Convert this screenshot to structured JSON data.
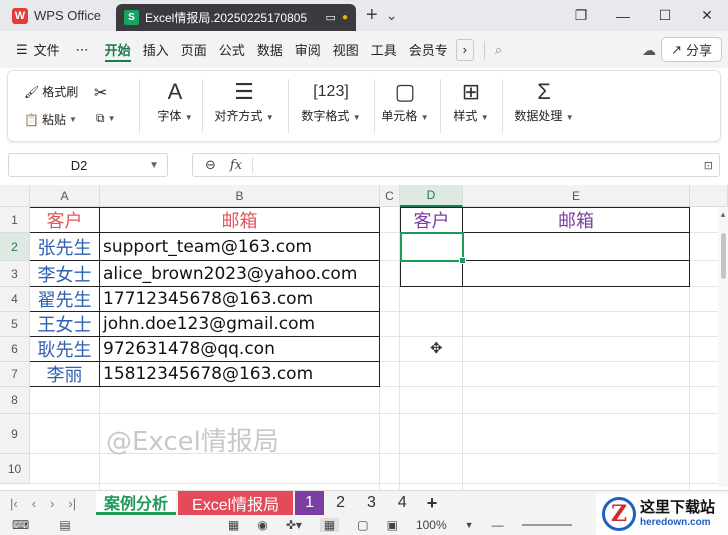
{
  "titlebar": {
    "app_name": "WPS Office",
    "doc_tab": "Excel情报局.20250225170805",
    "doc_icon": "S",
    "add": "+",
    "chevron": "⌄",
    "window_buttons": [
      "❐",
      "—",
      "☐",
      "✕"
    ]
  },
  "menubar": {
    "file": "文件",
    "more": "⋯",
    "items": [
      "开始",
      "插入",
      "页面",
      "公式",
      "数据",
      "审阅",
      "视图",
      "工具",
      "会员专"
    ],
    "share": "分享"
  },
  "ribbon": {
    "format_painter": "格式刷",
    "paste": "粘贴",
    "font": "字体",
    "align": "对齐方式",
    "number_format": "数字格式",
    "cell": "单元格",
    "style": "样式",
    "data_process": "数据处理"
  },
  "formulabar": {
    "cell_ref": "D2",
    "fx": "fx",
    "content": ""
  },
  "grid": {
    "columns": [
      "A",
      "B",
      "C",
      "D",
      "E"
    ],
    "rows": [
      "1",
      "2",
      "3",
      "4",
      "5",
      "6",
      "7",
      "8",
      "9",
      "10"
    ],
    "header_customer": "客户",
    "header_email": "邮箱",
    "records": [
      {
        "name": "张先生",
        "email": "support_team@163.com"
      },
      {
        "name": "李女士",
        "email": "alice_brown2023@yahoo.com"
      },
      {
        "name": "翟先生",
        "email": "17712345678@163.com"
      },
      {
        "name": "王女士",
        "email": "john.doe123@gmail.com"
      },
      {
        "name": "耿先生",
        "email": "972631478@qq.con"
      },
      {
        "name": "李丽",
        "email": "15812345678@163.com"
      }
    ],
    "output_header_customer": "客户",
    "output_header_email": "邮箱",
    "watermark": "@Excel情报局",
    "selected_cell": "D2"
  },
  "sheets": {
    "tabs": [
      "案例分析",
      "Excel情报局",
      "1",
      "2",
      "3",
      "4"
    ],
    "active": "案例分析",
    "add": "+"
  },
  "statusbar": {
    "zoom": "100%"
  },
  "brand": {
    "cn": "这里下载站",
    "en": "heredown.com",
    "logo": "Z"
  },
  "colors": {
    "accent": "#1e9a5a",
    "header_red": "#e0575b",
    "header_purple": "#7a3fa0",
    "name_blue": "#2f5fb3"
  }
}
